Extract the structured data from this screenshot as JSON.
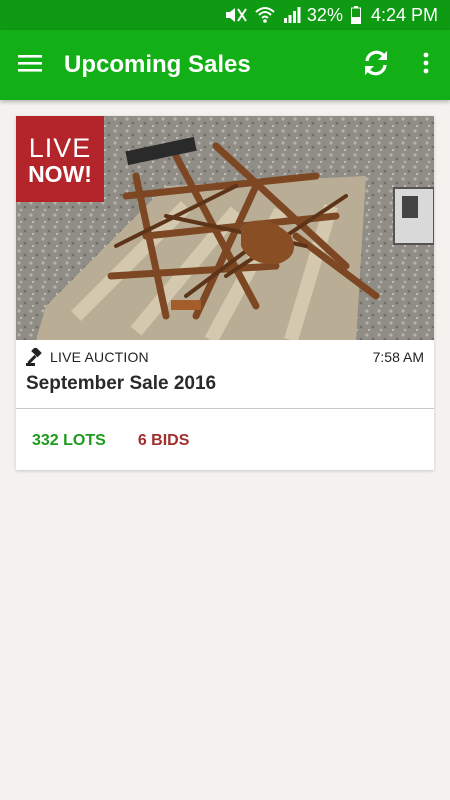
{
  "status_bar": {
    "battery": "32%",
    "time": "4:24 PM"
  },
  "app_bar": {
    "title": "Upcoming Sales",
    "icons": [
      "menu-icon",
      "refresh-icon",
      "more-vert-icon"
    ]
  },
  "sale_card": {
    "badge_line1": "LIVE",
    "badge_line2": "NOW!",
    "auction_type": "LIVE AUCTION",
    "time": "7:58 AM",
    "title": "September Sale 2016",
    "lots": "332 LOTS",
    "bids": "6 BIDS"
  },
  "colors": {
    "status_bar": "#0e9a13",
    "app_bar": "#12b016",
    "live_badge": "#b3242b",
    "lots_text": "#1e9b1e",
    "bids_text": "#a32e2e",
    "background": "#f3f2ee"
  }
}
